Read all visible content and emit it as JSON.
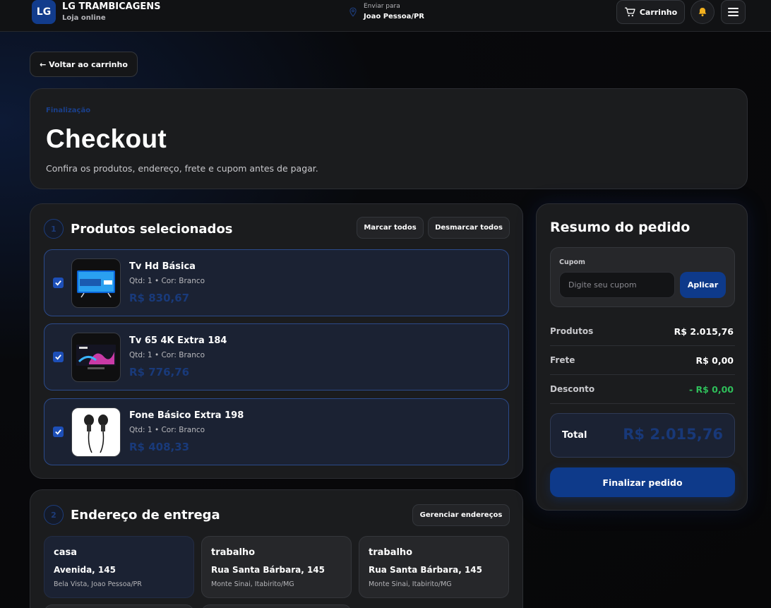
{
  "header": {
    "logo_text": "LG",
    "store_name": "LG TRAMBICAGENS",
    "store_sub": "Loja online",
    "ship_label": "Enviar para",
    "ship_value": "Joao Pessoa/PR",
    "cart_label": "Carrinho",
    "icons": {
      "pin": "map-pin-icon",
      "cart": "cart-icon",
      "bell": "bell-icon",
      "menu": "hamburger-menu-icon"
    }
  },
  "back_label": "← Voltar ao carrinho",
  "hero": {
    "eyebrow": "Finalização",
    "title": "Checkout",
    "subtitle": "Confira os produtos, endereço, frete e cupom antes de pagar."
  },
  "products_section": {
    "step": "1",
    "title": "Produtos selecionados",
    "select_all": "Marcar todos",
    "deselect_all": "Desmarcar todos",
    "items": [
      {
        "name": "Tv Hd Básica",
        "meta": "Qtd: 1 • Cor: Branco",
        "price": "R$ 830,67",
        "checked": true,
        "thumb": "tv-thumbnail"
      },
      {
        "name": "Tv 65 4K Extra 184",
        "meta": "Qtd: 1 • Cor: Branco",
        "price": "R$ 776,76",
        "checked": true,
        "thumb": "tv-thumbnail"
      },
      {
        "name": "Fone Básico Extra 198",
        "meta": "Qtd: 1 • Cor: Branco",
        "price": "R$ 408,33",
        "checked": true,
        "thumb": "earphones-thumbnail"
      }
    ]
  },
  "address_section": {
    "step": "2",
    "title": "Endereço de entrega",
    "manage_label": "Gerenciar endereços",
    "addresses": [
      {
        "tag": "casa",
        "street": "Avenida, 145",
        "city": "Bela Vista, Joao Pessoa/PR",
        "selected": true
      },
      {
        "tag": "trabalho",
        "street": "Rua Santa Bárbara, 145",
        "city": "Monte Sinai, Itabirito/MG",
        "selected": false
      },
      {
        "tag": "trabalho",
        "street": "Rua Santa Bárbara, 145",
        "city": "Monte Sinai, Itabirito/MG",
        "selected": false
      }
    ]
  },
  "summary": {
    "title": "Resumo do pedido",
    "coupon_label": "Cupom",
    "coupon_placeholder": "Digite seu cupom",
    "coupon_value": "",
    "apply_label": "Aplicar",
    "rows": [
      {
        "label": "Produtos",
        "value": "R$ 2.015,76"
      },
      {
        "label": "Frete",
        "value": "R$ 0,00"
      },
      {
        "label": "Desconto",
        "value": "- R$ 0,00"
      }
    ],
    "total_label": "Total",
    "total_value": "R$ 2.015,76",
    "finish_label": "Finalizar pedido"
  },
  "colors": {
    "accent": "#0e3a8a",
    "discount": "#2fbf5a",
    "background": "#070708"
  }
}
